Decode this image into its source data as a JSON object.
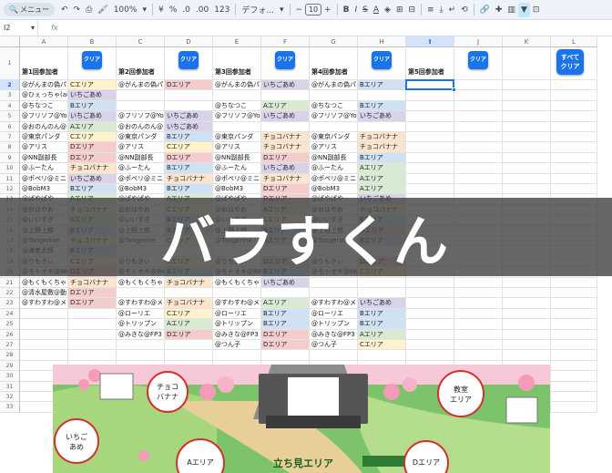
{
  "toolbar": {
    "menu_label": "メニュー",
    "zoom": "100%",
    "currency": "¥",
    "percent": "%",
    "dec_less": ".0",
    "dec_more": ".00",
    "number_format": "123",
    "font_name": "デフォ...",
    "font_size": "10"
  },
  "formula_bar": {
    "cell_ref": "I2",
    "fx": "fx"
  },
  "columns": [
    "A",
    "B",
    "C",
    "D",
    "E",
    "F",
    "G",
    "H",
    "I",
    "J",
    "K",
    "L"
  ],
  "selected_column": "I",
  "selected_row": 2,
  "rows": [
    "1",
    "2",
    "3",
    "4",
    "5",
    "6",
    "7",
    "8",
    "9",
    "10",
    "11",
    "12",
    "13",
    "14",
    "15",
    "16",
    "17",
    "18",
    "19",
    "20",
    "21",
    "22",
    "23",
    "24",
    "25",
    "26",
    "27",
    "28",
    "29",
    "30",
    "31",
    "32",
    "33"
  ],
  "round_headers": [
    "第1回参加者",
    "第2回参加者",
    "第3回参加者",
    "第4回参加者",
    "第5回参加者"
  ],
  "clear_label": "クリア",
  "clear_all_label": [
    "すべて",
    "クリア"
  ],
  "area_colors": {
    "A": "#d9ead3",
    "B": "#cfe2f3",
    "C": "#fff2cc",
    "D": "#f4cccc",
    "choco": "#fce5cd",
    "ichigo": "#d9d2e9",
    "kyoushitsu": "#ead1dc"
  },
  "rounds": [
    {
      "names": [
        "@がんまの偽パ",
        "@ひぇっちゃ(ai",
        "@ちなつこ",
        "@フリソフ@You",
        "@おのんのん@",
        "@東京パンダ",
        "@アリス",
        "@NN副部長",
        "@ふーたん",
        "@ポペリ@ミニ",
        "@BobM3",
        "@ぱやぱや",
        "@おはやお",
        "@いいすぎ",
        "@上野上郎",
        "@Tangerine",
        "@海老太郎",
        "@りもきぃ",
        "@モトオキ@We",
        "@もくもくちゃ",
        "@清水屋敷@動",
        "@すわすわ@メ",
        "",
        "",
        "",
        ""
      ],
      "areas": [
        "Cエリア",
        "いちごあめ",
        "Bエリア",
        "いちごあめ",
        "Aエリア",
        "Cエリア",
        "Dエリア",
        "Dエリア",
        "チョコバナナ",
        "いちごあめ",
        "Bエリア",
        "Aエリア",
        "チョコバナナ",
        "Aエリア",
        "Bエリア",
        "チョコバナナ",
        "Bエリア",
        "Cエリア",
        "Dエリア",
        "チョコバナナ",
        "Dエリア",
        "Dエリア",
        "",
        "",
        "",
        ""
      ],
      "keys": [
        "C",
        "ichigo",
        "B",
        "ichigo",
        "A",
        "C",
        "D",
        "D",
        "choco",
        "ichigo",
        "B",
        "A",
        "choco",
        "A",
        "B",
        "choco",
        "B",
        "C",
        "D",
        "choco",
        "D",
        "D",
        "",
        "",
        "",
        ""
      ]
    },
    {
      "names": [
        "@がんまの偽パ",
        "",
        "",
        "@フリソフ@You",
        "@おのんのん@",
        "@東京パンダ",
        "@アリス",
        "@NN副部長",
        "@ふーたん",
        "@ポペリ@ミニ",
        "@BobM3",
        "@ぱやぱや",
        "@おはやお",
        "@いいすぎ",
        "@上野上郎",
        "@Tangerine",
        "",
        "@りもきぃ",
        "@モトオキ@We",
        "@もくもくちゃ",
        "",
        "@すわすわ@メ",
        "@ローリエ",
        "@トリップン",
        "@みきな@FP3",
        ""
      ],
      "areas": [
        "Dエリア",
        "",
        "",
        "いちごあめ",
        "いちごあめ",
        "Bエリア",
        "Cエリア",
        "Dエリア",
        "Bエリア",
        "チョコバナナ",
        "Bエリア",
        "Aエリア",
        "Cエリア",
        "Bエリア",
        "Bエリア",
        "Cエリア",
        "",
        "Cエリア",
        "Bエリア",
        "チョコバナナ",
        "",
        "チョコバナナ",
        "Cエリア",
        "Aエリア",
        "Dエリア",
        ""
      ],
      "keys": [
        "D",
        "",
        "",
        "ichigo",
        "ichigo",
        "B",
        "C",
        "D",
        "B",
        "choco",
        "B",
        "A",
        "C",
        "B",
        "B",
        "C",
        "",
        "C",
        "B",
        "choco",
        "",
        "choco",
        "C",
        "A",
        "D",
        ""
      ]
    },
    {
      "names": [
        "@がんまの偽パ",
        "",
        "@ちなつこ",
        "@フリソフ@You",
        "",
        "@東京パンダ",
        "@アリス",
        "@NN副部長",
        "@ふーたん",
        "@ポペリ@ミニ",
        "@BobM3",
        "@ぱやぱや",
        "@おはやお",
        "@いいすぎ",
        "@上野上郎",
        "@Tangerine",
        "",
        "@りもきぃ",
        "@モトオキ@We",
        "@もくもくちゃ",
        "",
        "@すわすわ@メ",
        "@ローリエ",
        "@トリップン",
        "@みきな@FP3",
        "@つん子"
      ],
      "areas": [
        "いちごあめ",
        "",
        "Aエリア",
        "いちごあめ",
        "",
        "チョコバナナ",
        "チョコバナナ",
        "Dエリア",
        "いちごあめ",
        "チョコバナナ",
        "Dエリア",
        "Dエリア",
        "Aエリア",
        "Cエリア",
        "Bエリア",
        "Aエリア",
        "",
        "Dエリア",
        "Bエリア",
        "いちごあめ",
        "",
        "Aエリア",
        "Bエリア",
        "Bエリア",
        "Dエリア",
        "Dエリア"
      ],
      "keys": [
        "ichigo",
        "",
        "A",
        "ichigo",
        "",
        "choco",
        "choco",
        "D",
        "ichigo",
        "choco",
        "D",
        "D",
        "A",
        "C",
        "B",
        "A",
        "",
        "D",
        "B",
        "ichigo",
        "",
        "A",
        "B",
        "B",
        "D",
        "D"
      ]
    },
    {
      "names": [
        "@がんまの偽パ",
        "",
        "@ちなつこ",
        "@フリソフ@You",
        "",
        "@東京パンダ",
        "@アリス",
        "@NN副部長",
        "@ふーたん",
        "@ポペリ@ミニ",
        "@BobM3",
        "@ぱやぱや",
        "@おはやお",
        "@いいすぎ",
        "@上野上郎",
        "@Tangerine",
        "",
        "@りもきぃ",
        "@モトオキ@We",
        "",
        "",
        "@すわすわ@メ",
        "@ローリエ",
        "@トリップン",
        "@みきな@FP3",
        "@つん子"
      ],
      "areas": [
        "Bエリア",
        "",
        "Bエリア",
        "いちごあめ",
        "",
        "チョコバナナ",
        "チョコバナナ",
        "Bエリア",
        "Aエリア",
        "Aエリア",
        "Aエリア",
        "いちごあめ",
        "チョコバナナ",
        "Bエリア",
        "Dエリア",
        "Bエリア",
        "",
        "Dエリア",
        "Cエリア",
        "",
        "",
        "いちごあめ",
        "Bエリア",
        "Bエリア",
        "Aエリア",
        "Cエリア"
      ],
      "keys": [
        "B",
        "",
        "B",
        "ichigo",
        "",
        "choco",
        "choco",
        "B",
        "A",
        "A",
        "A",
        "ichigo",
        "choco",
        "B",
        "D",
        "B",
        "",
        "D",
        "C",
        "",
        "",
        "ichigo",
        "B",
        "B",
        "A",
        "C"
      ]
    }
  ],
  "map": {
    "choco": [
      "チョコ",
      "バナナ"
    ],
    "ichigo": [
      "いちご",
      "あめ"
    ],
    "kyoushitsu": [
      "教室",
      "エリア"
    ],
    "a_area": "Aエリア",
    "d_area": "Dエリア",
    "tachimi": "立ち見エリア"
  },
  "overlay_title": "バラすくん"
}
